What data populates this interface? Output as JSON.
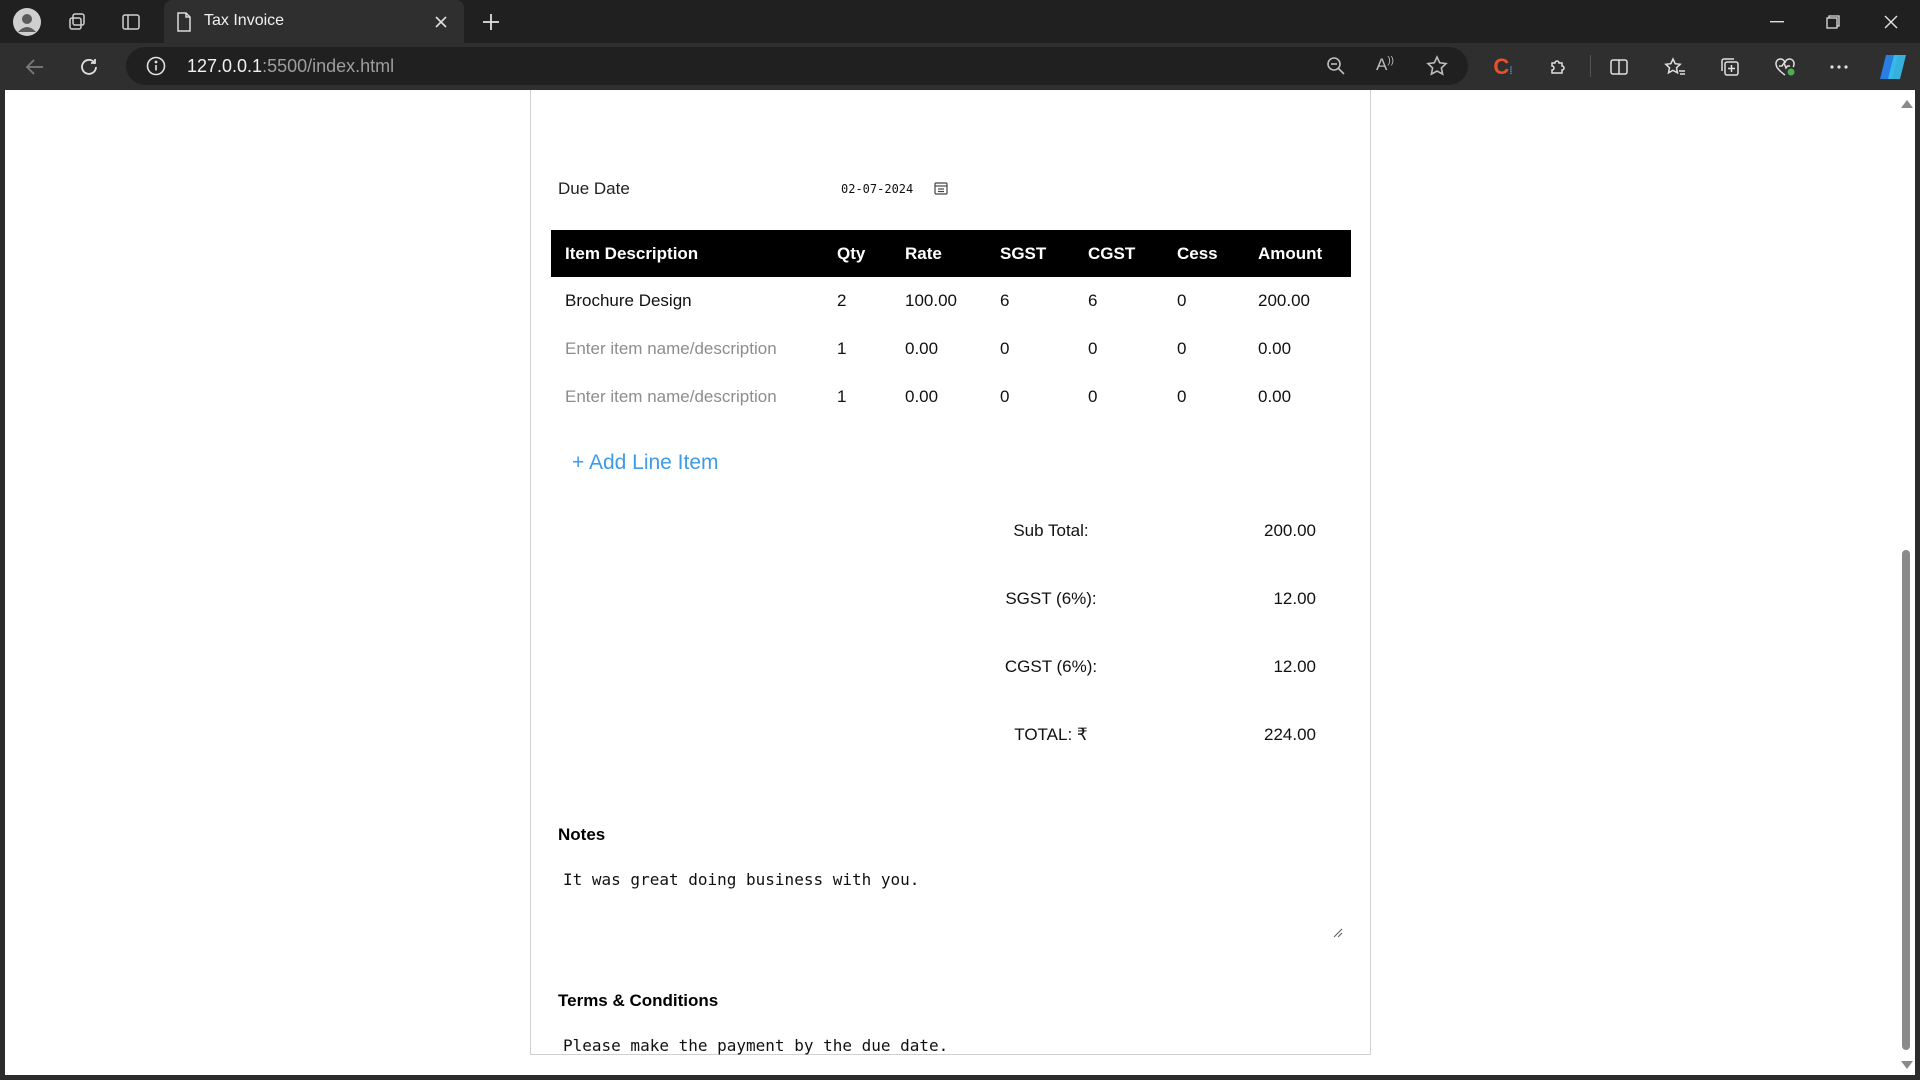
{
  "browser": {
    "tab_title": "Tax Invoice",
    "url_host": "127.0.0.1",
    "url_rest": ":5500/index.html"
  },
  "invoice": {
    "due_date_label": "Due Date",
    "due_date_value": "02-07-2024",
    "columns": [
      "Item Description",
      "Qty",
      "Rate",
      "SGST",
      "CGST",
      "Cess",
      "Amount"
    ],
    "rows": [
      {
        "description": "Brochure Design",
        "placeholder": false,
        "qty": "2",
        "rate": "100.00",
        "sgst": "6",
        "cgst": "6",
        "cess": "0",
        "amount": "200.00"
      },
      {
        "description": "Enter item name/description",
        "placeholder": true,
        "qty": "1",
        "rate": "0.00",
        "sgst": "0",
        "cgst": "0",
        "cess": "0",
        "amount": "0.00"
      },
      {
        "description": "Enter item name/description",
        "placeholder": true,
        "qty": "1",
        "rate": "0.00",
        "sgst": "0",
        "cgst": "0",
        "cess": "0",
        "amount": "0.00"
      }
    ],
    "add_line_label": "+ Add Line Item",
    "totals": {
      "subtotal_label": "Sub Total:",
      "subtotal_value": "200.00",
      "sgst_label": "SGST (6%):",
      "sgst_value": "12.00",
      "cgst_label": "CGST (6%):",
      "cgst_value": "12.00",
      "total_label": "TOTAL: ₹",
      "total_value": "224.00"
    },
    "notes_label": "Notes",
    "notes_value": "It was great doing business with you.",
    "terms_label": "Terms & Conditions",
    "terms_value": "Please make the payment by the due date."
  },
  "colors": {
    "link": "#3d9be9",
    "header_bg": "#000000",
    "placeholder": "#8d8d8d"
  }
}
